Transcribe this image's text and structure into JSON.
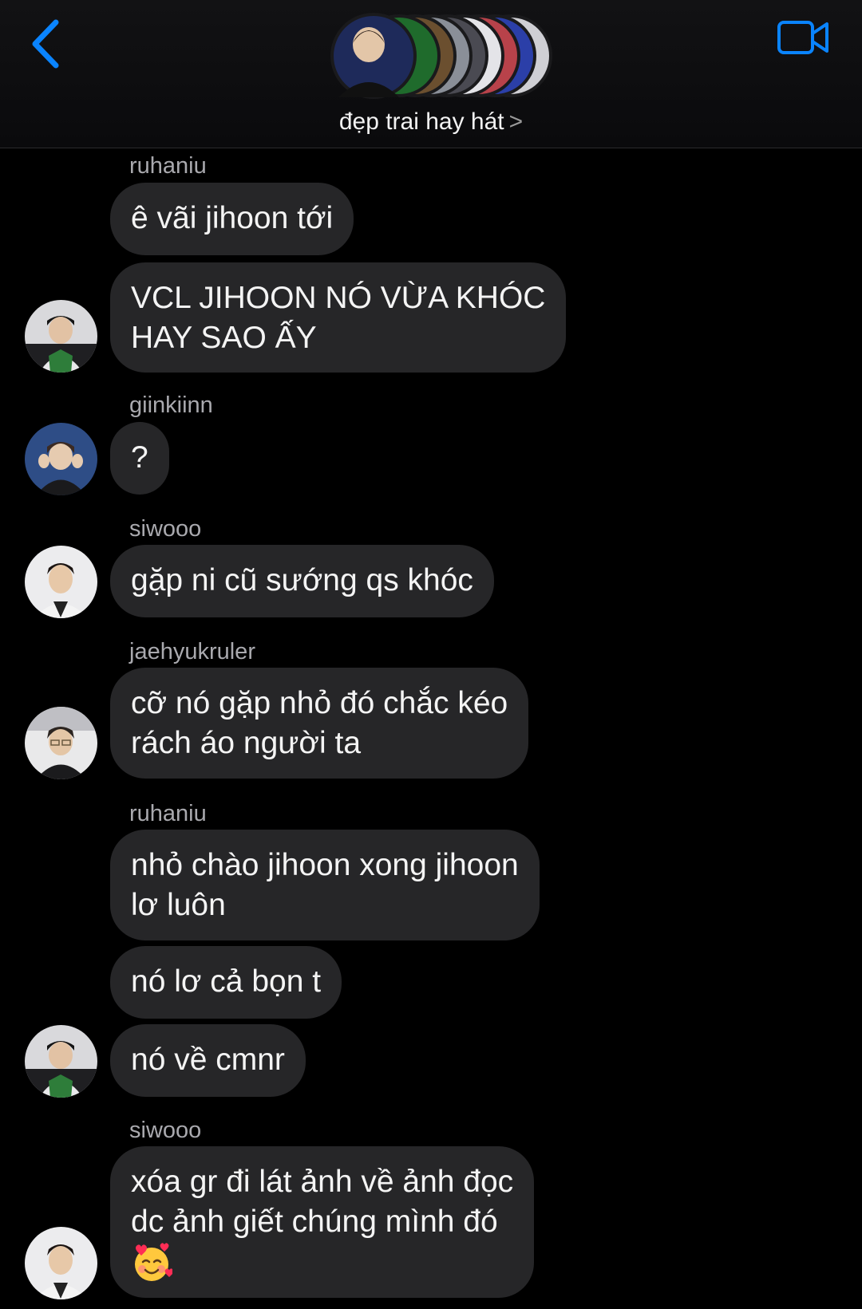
{
  "header": {
    "group_name": "đẹp trai hay hát",
    "chevron": ">",
    "back_icon": "chevron-left-icon",
    "video_icon": "video-camera-icon",
    "accent_color": "#0a84ff"
  },
  "messages": [
    {
      "sender": "ruhaniu",
      "lines": [
        "ê vãi jihoon tới"
      ]
    },
    {
      "lines": [
        "VCL JIHOON NÓ VỪA KHÓC",
        "HAY SAO ẤY"
      ],
      "avatar": "ruhaniu"
    },
    {
      "sender": "giinkiinn",
      "lines": [
        "?"
      ],
      "avatar": "giinkiinn"
    },
    {
      "sender": "siwooo",
      "lines": [
        "gặp ni cũ sướng qs khóc"
      ],
      "avatar": "siwooo"
    },
    {
      "sender": "jaehyukruler",
      "lines": [
        "cỡ nó gặp nhỏ đó chắc kéo",
        "rách áo người ta"
      ],
      "avatar": "jaehyukruler"
    },
    {
      "sender": "ruhaniu",
      "lines": [
        "nhỏ chào jihoon xong jihoon",
        "lơ luôn"
      ]
    },
    {
      "lines": [
        "nó lơ cả bọn t"
      ]
    },
    {
      "lines": [
        "nó về cmnr"
      ],
      "avatar": "ruhaniu"
    },
    {
      "sender": "siwooo",
      "lines": [
        "xóa gr đi lát ảnh về ảnh đọc",
        "dc ảnh giết chúng mình đó"
      ],
      "emoji": "smiling-face-with-hearts-icon",
      "avatar": "siwooo"
    }
  ]
}
